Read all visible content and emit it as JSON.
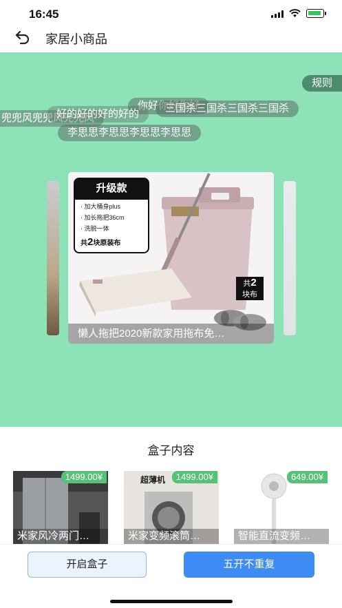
{
  "status": {
    "time": "16:45"
  },
  "nav": {
    "title": "家居小商品"
  },
  "stage": {
    "background": "#8ee2b8",
    "rules_label": "规则",
    "danmu": [
      "兜兜风兜兜风兜兜风",
      "好的好的好的好的",
      "你好你好你好",
      "三国杀三国杀三国杀三国杀",
      "李思思李思思李思思李思思"
    ],
    "main_card": {
      "badge_title": "升级款",
      "features": [
        "· 加大桶身plus",
        "· 加长拖把36cm",
        "· 洗脱一体"
      ],
      "footer_pre": "共",
      "footer_num": "2",
      "footer_post": "块原装布",
      "tag_pre": "共",
      "tag_num": "2",
      "tag_post": "块布",
      "caption": "懒人拖把2020新款家用拖布免…"
    }
  },
  "contents": {
    "title": "盒子内容",
    "items": [
      {
        "price": "1499.00¥",
        "name": "米家风冷两门…"
      },
      {
        "price": "1499.00¥",
        "name": "米家变频滚筒…",
        "label": "超薄机"
      },
      {
        "price": "649.00¥",
        "name": "智能直流变频…"
      }
    ]
  },
  "actions": {
    "open_label": "开启盒子",
    "five_label": "五开不重复",
    "accent": "#3d8bf5"
  }
}
